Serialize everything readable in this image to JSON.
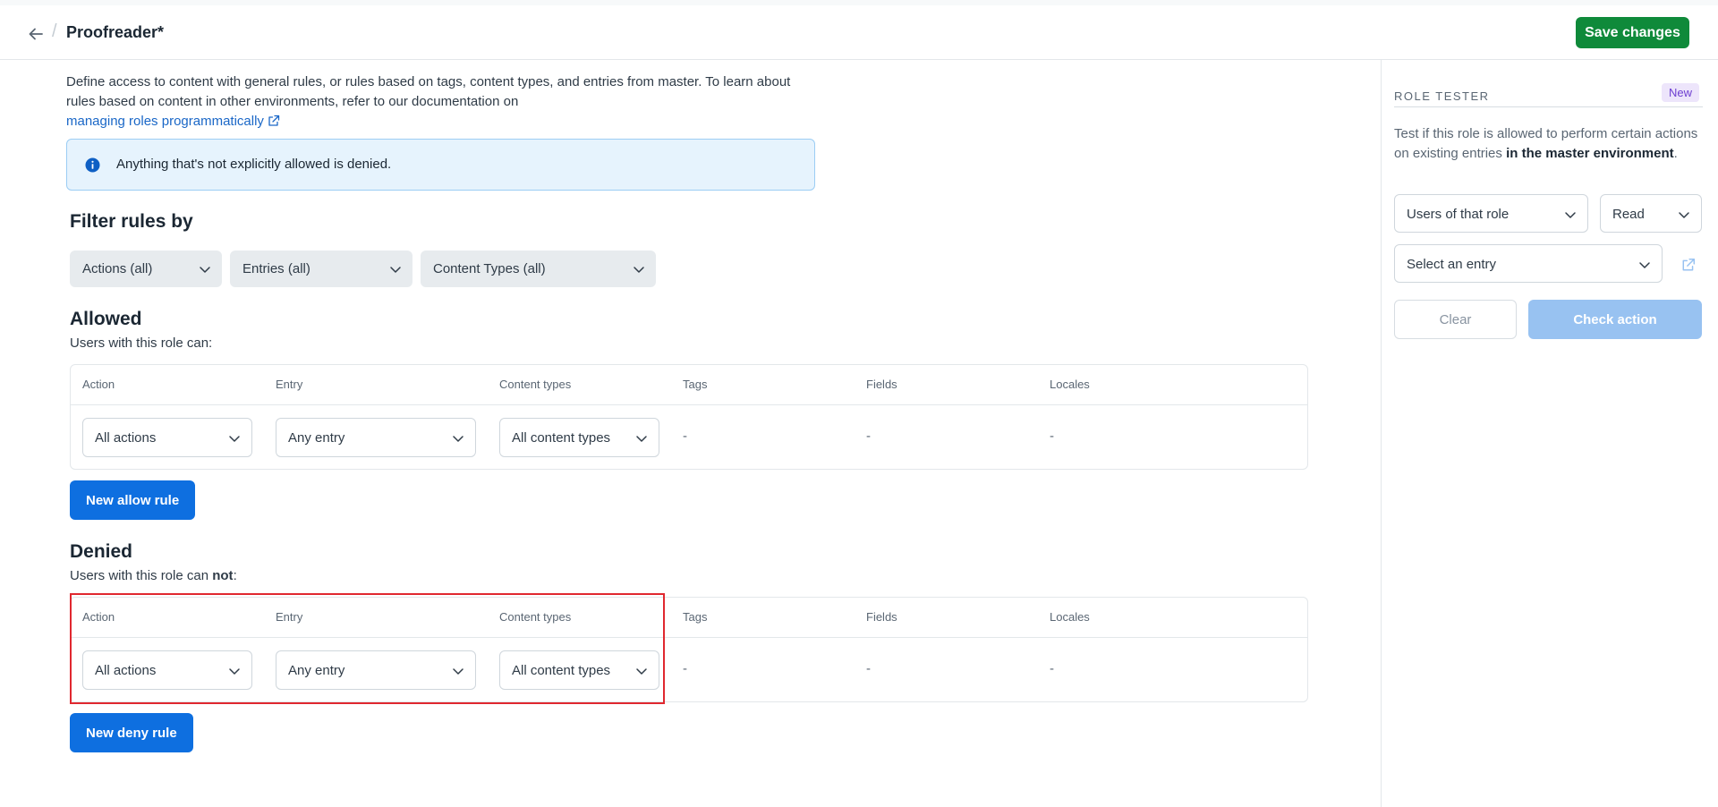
{
  "header": {
    "title": "Proofreader*",
    "save_label": "Save changes"
  },
  "intro": {
    "text": "Define access to content with general rules, or rules based on tags, content types, and entries from master. To learn about rules based on content in other environments, refer to our documentation on",
    "link_text": "managing roles programmatically"
  },
  "info": {
    "text": "Anything that's not explicitly allowed is denied."
  },
  "filter": {
    "title": "Filter rules by",
    "selects": [
      "Actions (all)",
      "Entries (all)",
      "Content Types (all)"
    ]
  },
  "columns": [
    "Action",
    "Entry",
    "Content types",
    "Tags",
    "Fields",
    "Locales"
  ],
  "allowed": {
    "title": "Allowed",
    "subtitle": "Users with this role can:",
    "row": {
      "action": "All actions",
      "entry": "Any entry",
      "content_types": "All content types",
      "tags": "-",
      "fields": "-",
      "locales": "-"
    },
    "button_label": "New allow rule"
  },
  "denied": {
    "title": "Denied",
    "subtitle_prefix": "Users with this role can ",
    "subtitle_bold": "not",
    "subtitle_suffix": ":",
    "row": {
      "action": "All actions",
      "entry": "Any entry",
      "content_types": "All content types",
      "tags": "-",
      "fields": "-",
      "locales": "-"
    },
    "button_label": "New deny rule"
  },
  "role_tester": {
    "title": "ROLE TESTER",
    "badge": "New",
    "desc_prefix": "Test if this role is allowed to perform certain actions on existing entries ",
    "desc_bold": "in the master environment",
    "desc_suffix": ".",
    "users_select": "Users of that role",
    "action_select": "Read",
    "entry_select": "Select an entry",
    "clear_label": "Clear",
    "check_label": "Check action"
  },
  "colors": {
    "primary": "#0e6fe0",
    "save": "#0f8a3a",
    "highlight": "#e0282f",
    "badge_bg": "#ede5fb"
  },
  "icons": [
    "arrow-left-icon",
    "external-link-icon",
    "info-icon",
    "chevron-down-icon"
  ]
}
